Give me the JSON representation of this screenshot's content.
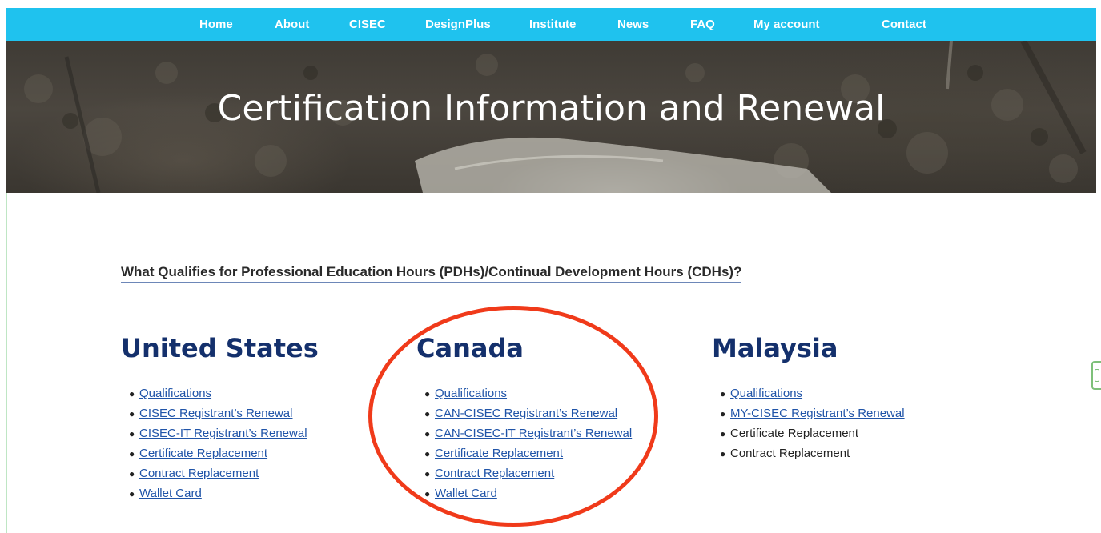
{
  "nav": {
    "items": [
      {
        "label": "Home"
      },
      {
        "label": "About"
      },
      {
        "label": "CISEC"
      },
      {
        "label": "DesignPlus"
      },
      {
        "label": "Institute"
      },
      {
        "label": "News"
      },
      {
        "label": "FAQ"
      },
      {
        "label": "My account"
      },
      {
        "label": "Contact"
      }
    ]
  },
  "hero": {
    "title": "Certification Information and Renewal"
  },
  "pdh_link": "What Qualifies for Professional Education Hours (PDHs)/Continual Development Hours (CDHs)?",
  "regions": [
    {
      "heading": "United States",
      "items": [
        {
          "label": "Qualifications",
          "link": true
        },
        {
          "label": "CISEC Registrant’s Renewal",
          "link": true
        },
        {
          "label": "CISEC-IT Registrant’s Renewal",
          "link": true
        },
        {
          "label": "Certificate Replacement",
          "link": true
        },
        {
          "label": "Contract Replacement",
          "link": true
        },
        {
          "label": "Wallet Card",
          "link": true
        }
      ]
    },
    {
      "heading": "Canada",
      "items": [
        {
          "label": "Qualifications",
          "link": true
        },
        {
          "label": "CAN-CISEC Registrant’s Renewal",
          "link": true
        },
        {
          "label": "CAN-CISEC-IT Registrant’s Renewal",
          "link": true
        },
        {
          "label": "Certificate Replacement",
          "link": true
        },
        {
          "label": "Contract Replacement",
          "link": true
        },
        {
          "label": "Wallet Card",
          "link": true
        }
      ]
    },
    {
      "heading": "Malaysia",
      "items": [
        {
          "label": "Qualifications",
          "link": true
        },
        {
          "label": "MY-CISEC Registrant’s Renewal",
          "link": true
        },
        {
          "label": "Certificate Replacement",
          "link": false
        },
        {
          "label": "Contract Replacement",
          "link": false
        }
      ]
    }
  ],
  "colors": {
    "nav_bg": "#1fc2ee",
    "heading": "#14306c",
    "link": "#2054a8",
    "annotation_circle": "#f03a1a"
  }
}
